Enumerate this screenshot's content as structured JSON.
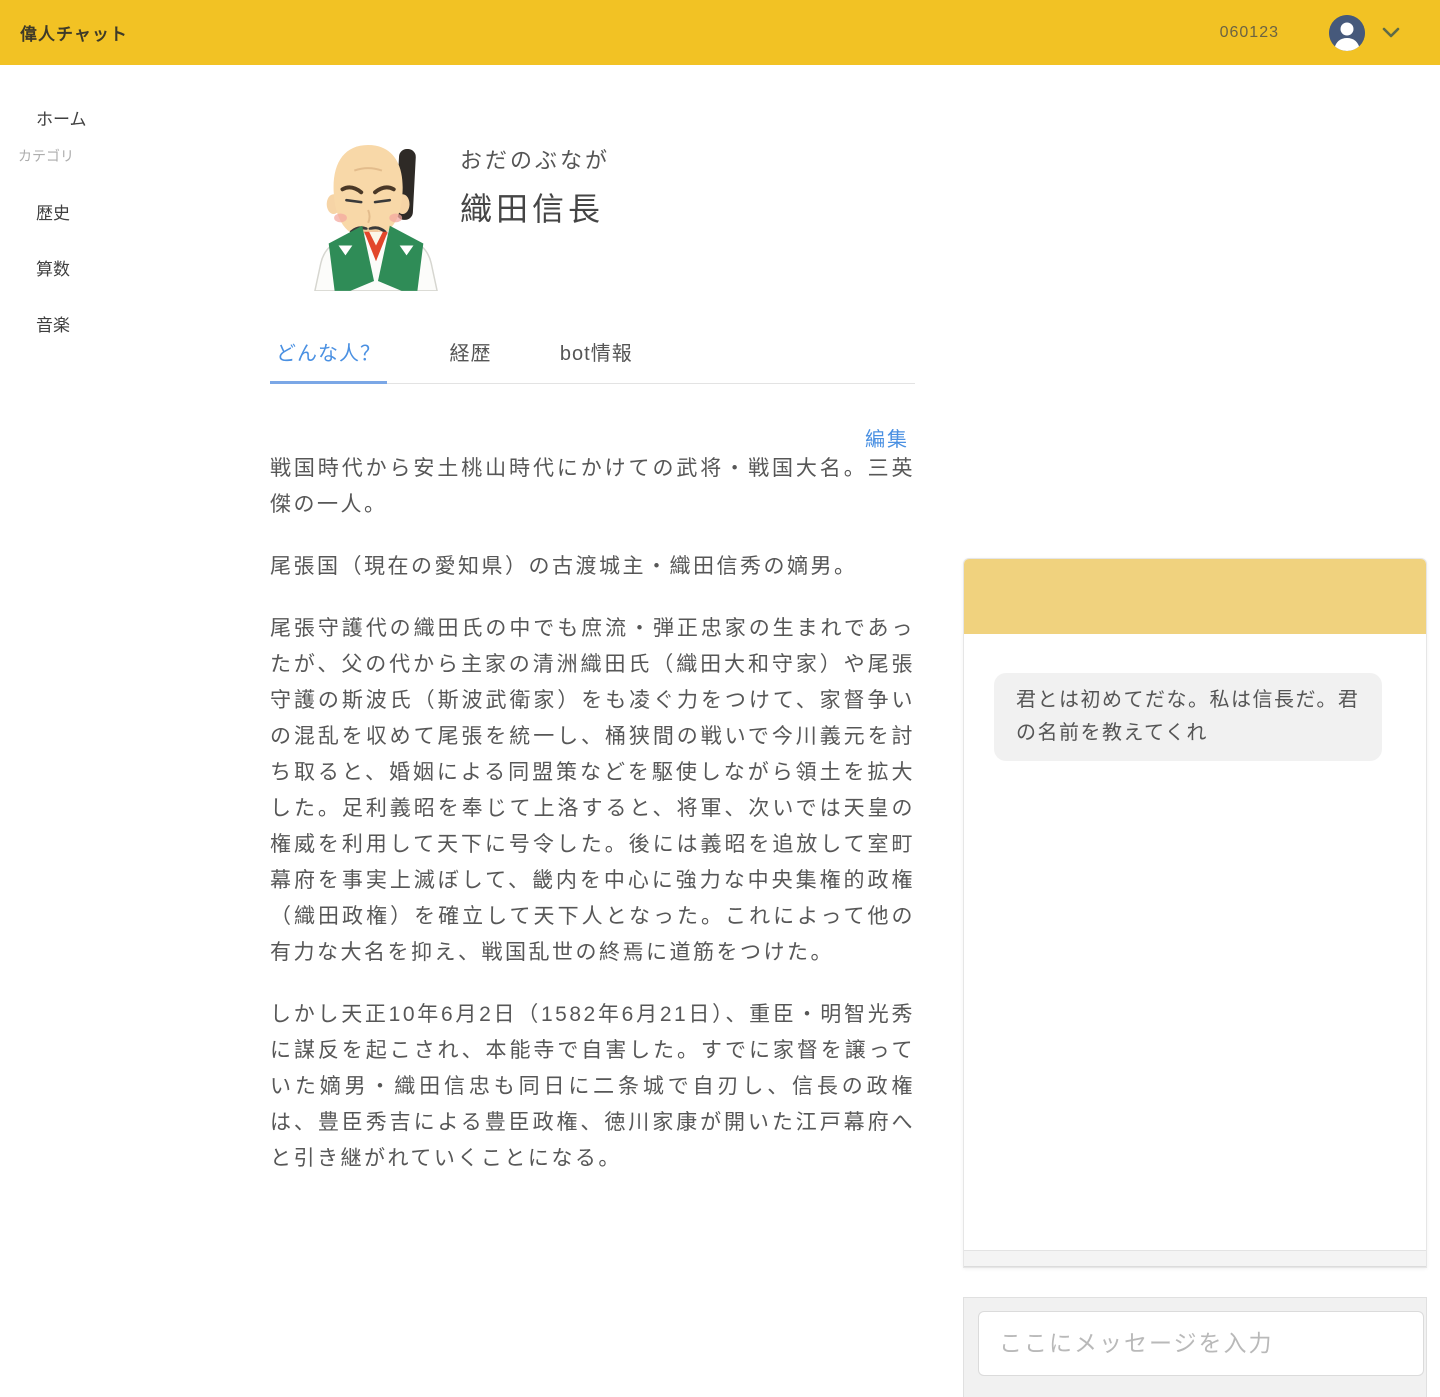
{
  "header": {
    "app_title": "偉人チャット",
    "user_id": "060123"
  },
  "sidebar": {
    "home_label": "ホーム",
    "category_label": "カテゴリ",
    "items": [
      {
        "label": "歴史"
      },
      {
        "label": "算数"
      },
      {
        "label": "音楽"
      }
    ]
  },
  "profile": {
    "furigana": "おだのぶなが",
    "name": "織田信長",
    "tabs": [
      {
        "label": "どんな人？",
        "active": true
      },
      {
        "label": "経歴",
        "active": false
      },
      {
        "label": "bot情報",
        "active": false
      }
    ],
    "edit_label": "編集",
    "paragraphs": [
      "戦国時代から安土桃山時代にかけての武将・戦国大名。三英傑の一人。",
      "尾張国（現在の愛知県）の古渡城主・織田信秀の嫡男。",
      "尾張守護代の織田氏の中でも庶流・弾正忠家の生まれであったが、父の代から主家の清洲織田氏（織田大和守家）や尾張守護の斯波氏（斯波武衛家）をも凌ぐ力をつけて、家督争いの混乱を収めて尾張を統一し、桶狭間の戦いで今川義元を討ち取ると、婚姻による同盟策などを駆使しながら領土を拡大した。足利義昭を奉じて上洛すると、将軍、次いでは天皇の権威を利用して天下に号令した。後には義昭を追放して室町幕府を事実上滅ぼして、畿内を中心に強力な中央集権的政権（織田政権）を確立して天下人となった。これによって他の有力な大名を抑え、戦国乱世の終焉に道筋をつけた。",
      "しかし天正10年6月2日（1582年6月21日）、重臣・明智光秀に謀反を起こされ、本能寺で自害した。すでに家督を譲っていた嫡男・織田信忠も同日に二条城で自刃し、信長の政権は、豊臣秀吉による豊臣政権、徳川家康が開いた江戸幕府へと引き継がれていくことになる。"
    ]
  },
  "chat": {
    "bot_message": "君とは初めてだな。私は信長だ。君の名前を教えてくれ",
    "input_placeholder": "ここにメッセージを入力"
  },
  "icons": {
    "user_avatar": "person-icon",
    "user_menu": "chevron-down-icon"
  },
  "colors": {
    "header_bg": "#F2C224",
    "chat_header_bg": "#F0D27E",
    "accent_blue": "#4A90E2",
    "bubble_bg": "#F1F1F1",
    "avatar_circle": "#46597B"
  }
}
